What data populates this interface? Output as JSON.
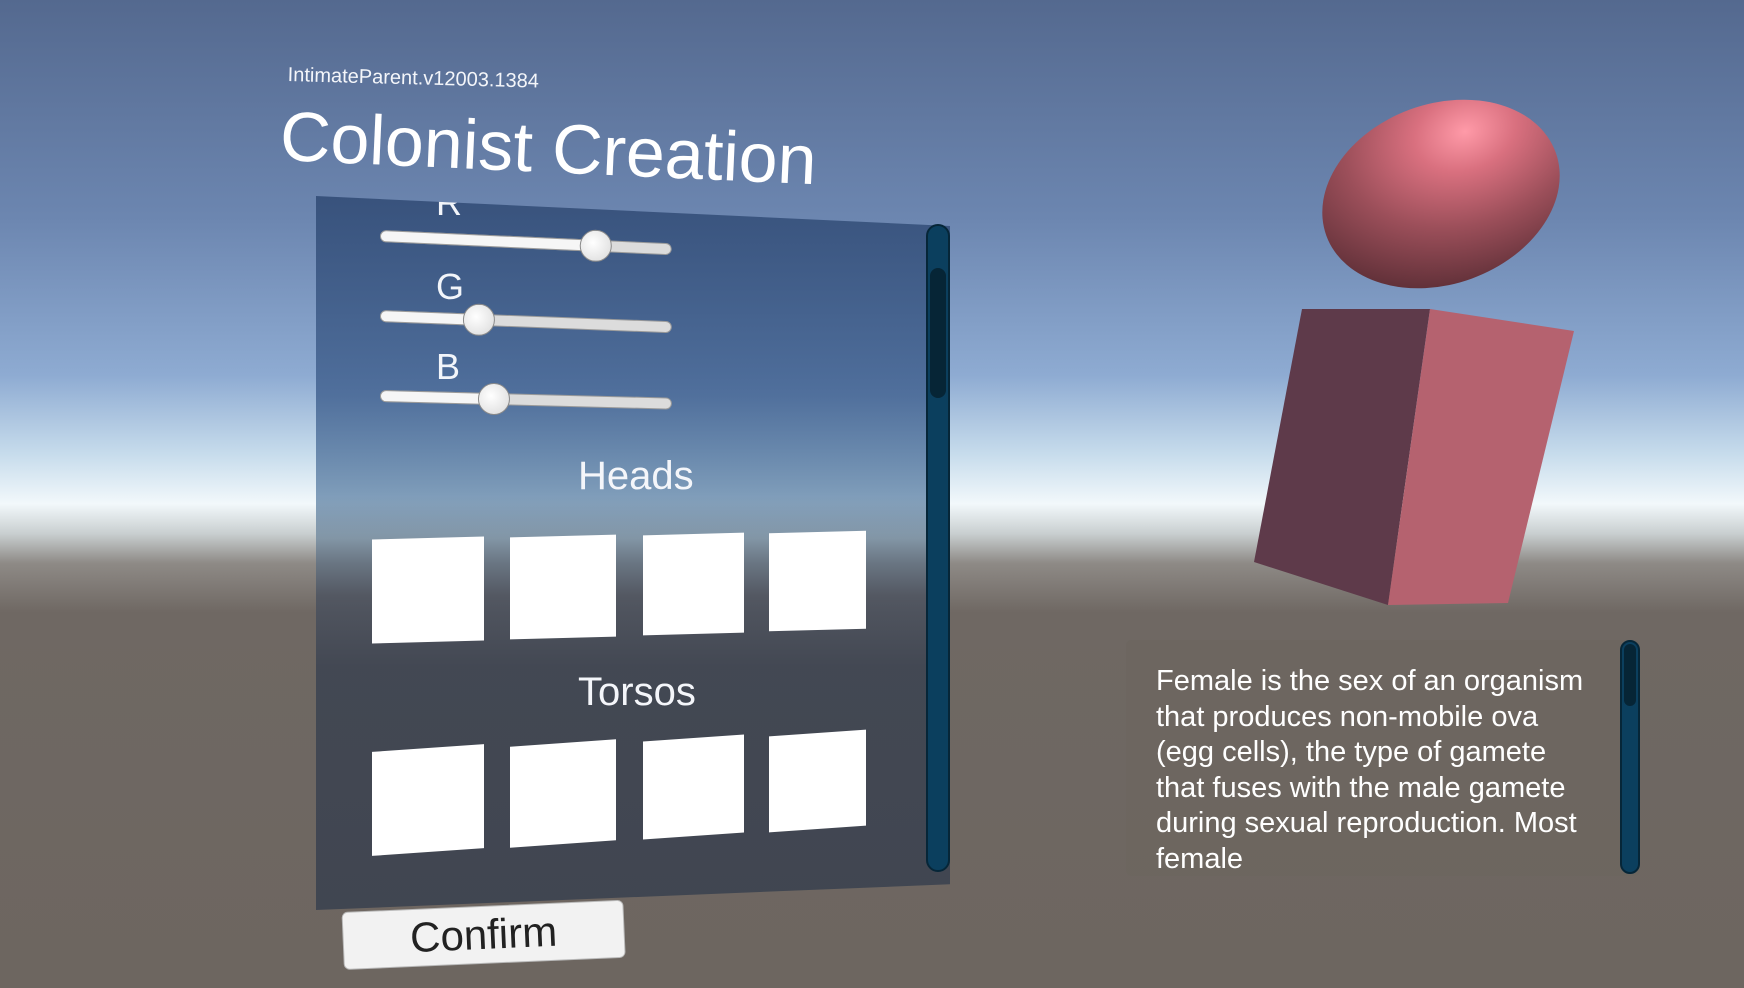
{
  "app": {
    "version_label": "IntimateParent.v12003.1384",
    "title": "Colonist Creation"
  },
  "color_sliders": [
    {
      "label": "R",
      "value": 0.74
    },
    {
      "label": "G",
      "value": 0.34
    },
    {
      "label": "B",
      "value": 0.39
    }
  ],
  "sections": {
    "heads": {
      "title": "Heads",
      "option_count": 4
    },
    "torsos": {
      "title": "Torsos",
      "option_count": 4
    }
  },
  "buttons": {
    "confirm_label": "Confirm"
  },
  "description": {
    "text": "Female is the sex of an organism that produces non-mobile ova (egg cells), the type of gamete that fuses with the male gamete during sexual reproduction. Most female"
  },
  "colors": {
    "character_color": "#b8616f",
    "scrollbar": "#0b3f5e",
    "scrollbar_handle": "#062536"
  }
}
